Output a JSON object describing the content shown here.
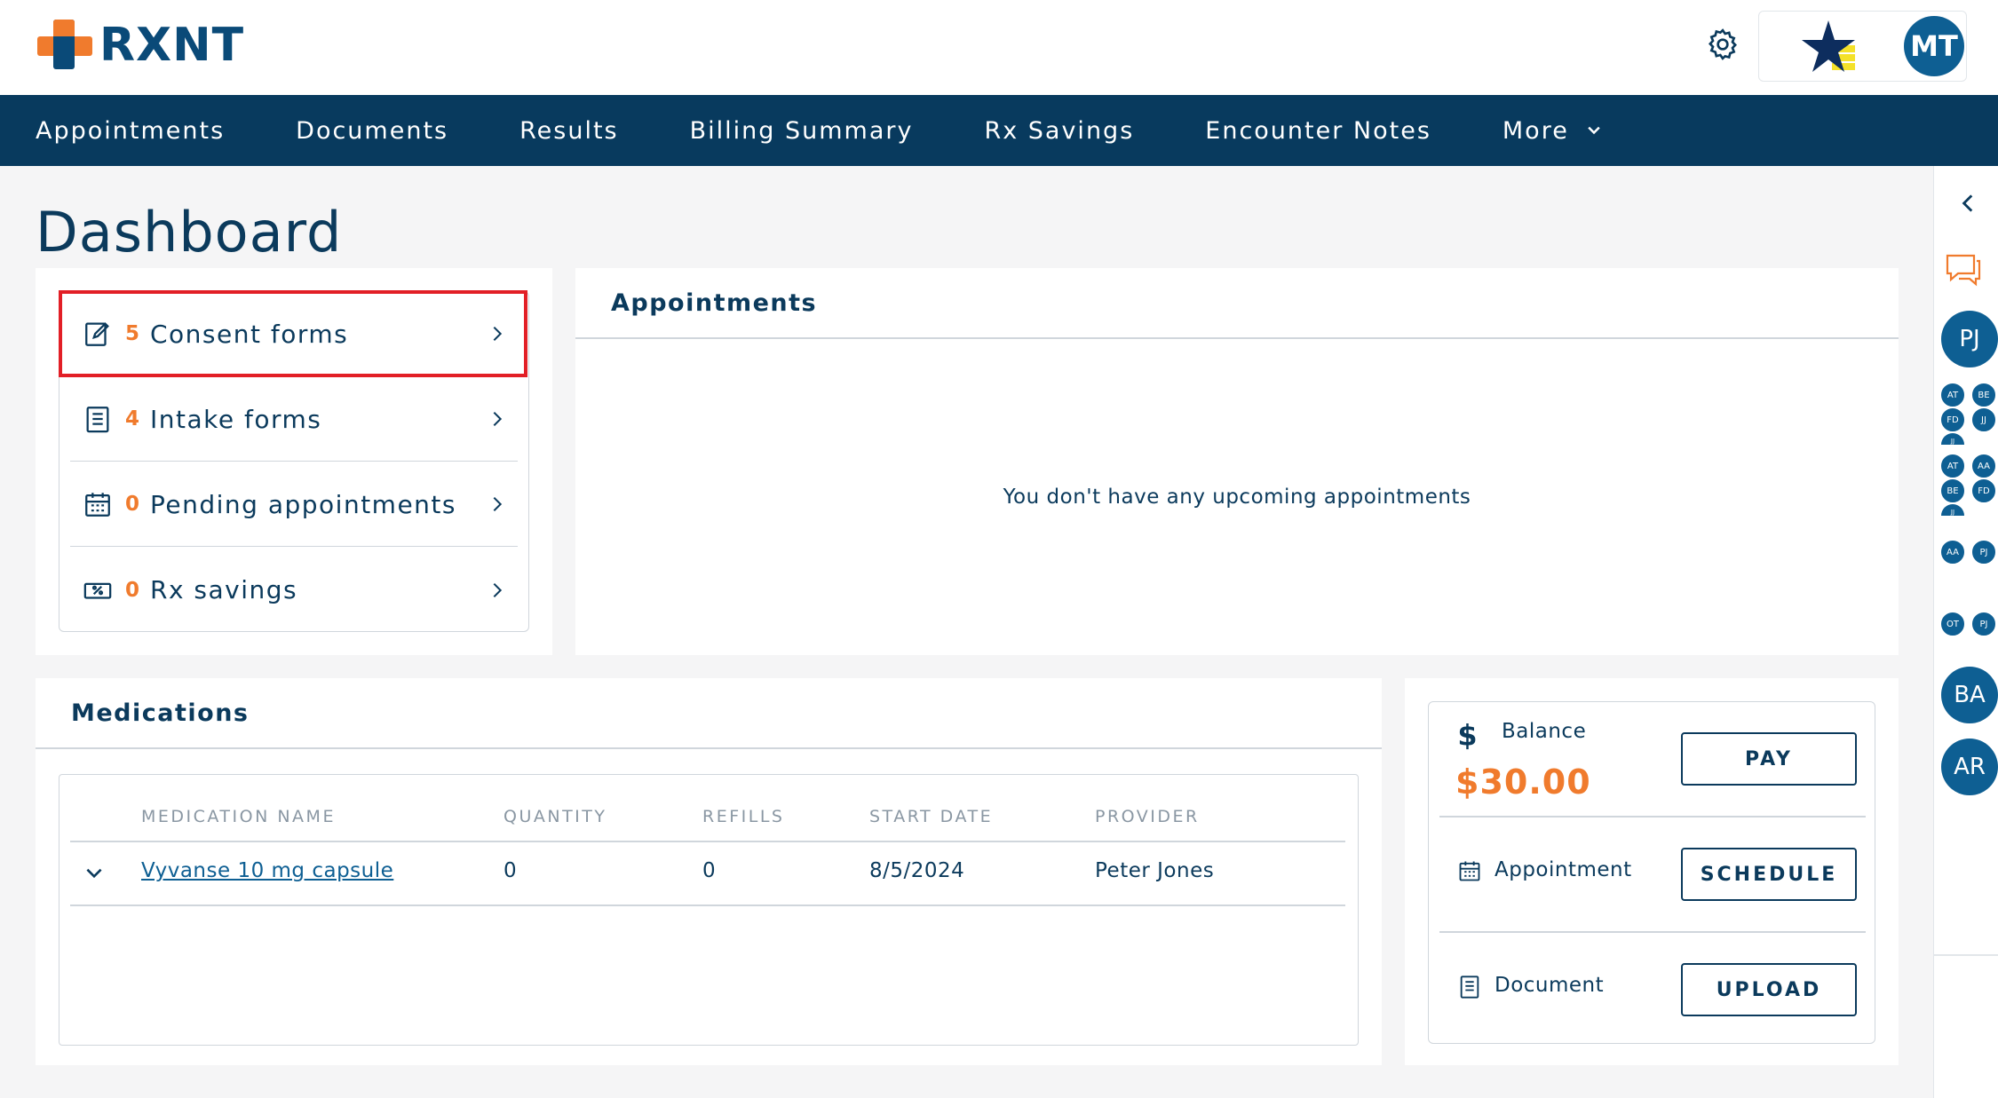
{
  "header": {
    "brand": "RXNT",
    "user_initials": "MT"
  },
  "nav": {
    "items": [
      "Appointments",
      "Documents",
      "Results",
      "Billing Summary",
      "Rx Savings",
      "Encounter Notes"
    ],
    "more_label": "More"
  },
  "page": {
    "title": "Dashboard"
  },
  "forms": [
    {
      "count": "5",
      "label": "Consent forms",
      "icon": "edit-document-icon"
    },
    {
      "count": "4",
      "label": "Intake forms",
      "icon": "clipboard-icon"
    },
    {
      "count": "0",
      "label": "Pending appointments",
      "icon": "calendar-icon"
    },
    {
      "count": "0",
      "label": "Rx savings",
      "icon": "discount-ticket-icon"
    }
  ],
  "appointments": {
    "title": "Appointments",
    "empty_message": "You don't have any upcoming appointments"
  },
  "medications": {
    "title": "Medications",
    "columns": [
      "MEDICATION NAME",
      "QUANTITY",
      "REFILLS",
      "START DATE",
      "PROVIDER"
    ],
    "rows": [
      {
        "name": "Vyvanse 10 mg capsule",
        "quantity": "0",
        "refills": "0",
        "start_date": "8/5/2024",
        "provider": "Peter Jones"
      }
    ]
  },
  "billing": {
    "balance_label": "Balance",
    "balance_amount": "$30.00",
    "pay_label": "PAY",
    "appointment_label": "Appointment",
    "schedule_label": "SCHEDULE",
    "document_label": "Document",
    "upload_label": "UPLOAD"
  },
  "rail": {
    "avatars_big": [
      "PJ",
      "BA",
      "AR"
    ],
    "group1": [
      "AT",
      "BE",
      "FD",
      "JJ",
      "JJ"
    ],
    "group2": [
      "AT",
      "AA",
      "BE",
      "FD",
      "JJ"
    ],
    "pair1": [
      "AA",
      "PJ"
    ],
    "pair2": [
      "OT",
      "PJ"
    ]
  },
  "colors": {
    "navy": "#083a5e",
    "accent_orange": "#f07b2d",
    "avatar_blue": "#0e5f93",
    "highlight_red": "#e21f26"
  }
}
